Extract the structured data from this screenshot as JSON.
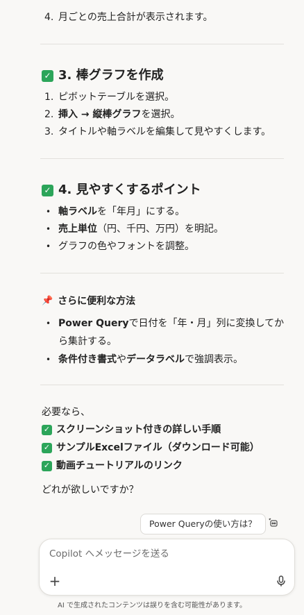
{
  "top_list": {
    "items": [
      {
        "num": "4.",
        "text": "月ごとの売上合計が表示されます。"
      }
    ]
  },
  "section3": {
    "title": "3. 棒グラフを作成",
    "items": [
      {
        "num": "1.",
        "text": "ピボットテーブルを選択。"
      },
      {
        "num": "2.",
        "bold": "挿入 → 縦棒グラフ",
        "rest": "を選択。"
      },
      {
        "num": "3.",
        "text": "タイトルや軸ラベルを編集して見やすくします。"
      }
    ]
  },
  "section4": {
    "title": "4. 見やすくするポイント",
    "items": [
      {
        "bold": "軸ラベル",
        "rest": "を「年月」にする。"
      },
      {
        "bold": "売上単位",
        "rest": "（円、千円、万円）を明記。"
      },
      {
        "text": "グラフの色やフォントを調整。"
      }
    ]
  },
  "tips": {
    "title": "さらに便利な方法",
    "item1_bold": "Power Query",
    "item1_rest_line1": "で日付を「年・月」列に変換してか",
    "item1_rest_line2": "ら集計する。",
    "item2_bold1": "条件付き書式",
    "item2_mid": "や",
    "item2_bold2": "データラベル",
    "item2_rest": "で強調表示。"
  },
  "offer": {
    "intro": "必要なら、",
    "options": [
      "スクリーンショット付きの詳しい手順",
      "サンプルExcelファイル（ダウンロード可能）",
      "動画チュートリアルのリンク"
    ],
    "question": "どれが欲しいですか？"
  },
  "suggestion": {
    "label": "Power Queryの使い方は？"
  },
  "composer": {
    "placeholder": "Copilot へメッセージを送る"
  },
  "disclaimer": "AI で生成されたコンテンツは誤りを含む可能性があります。",
  "icons": {
    "check": "check-box-icon",
    "pin": "pushpin-icon",
    "plus": "plus-icon",
    "mic": "microphone-icon",
    "sparkle": "sparkle-icon"
  },
  "colors": {
    "check_green": "#2ca55a",
    "pin_red": "#d8334a"
  }
}
